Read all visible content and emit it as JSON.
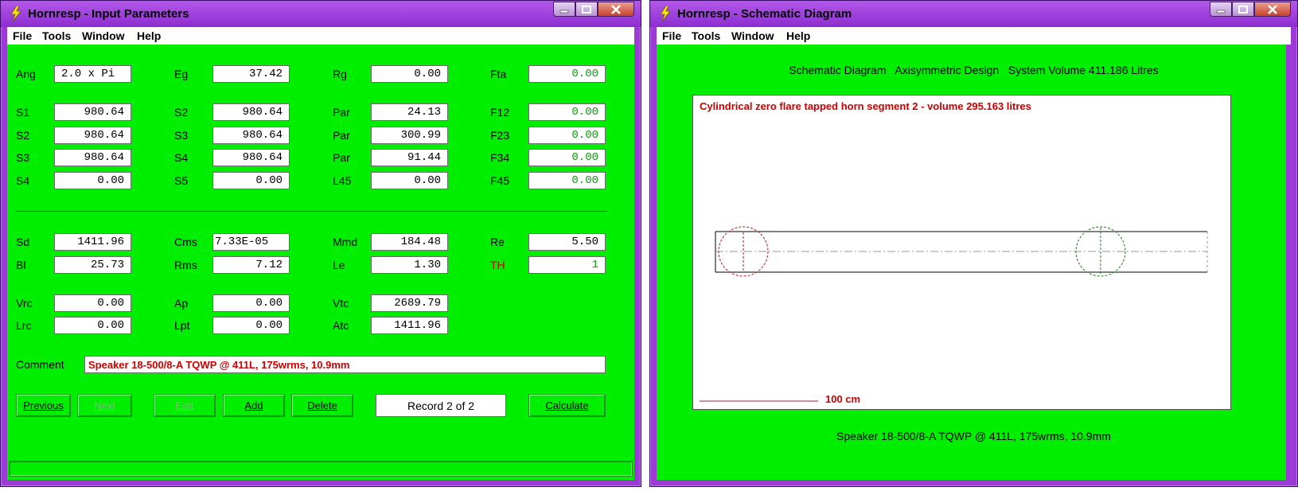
{
  "left_window": {
    "title": "Hornresp - Input Parameters",
    "menu": [
      "File",
      "Tools",
      "Window",
      "Help"
    ],
    "fields": {
      "ang": {
        "label": "Ang",
        "value": "2.0 x Pi"
      },
      "eg": {
        "label": "Eg",
        "value": "37.42"
      },
      "rg": {
        "label": "Rg",
        "value": "0.00"
      },
      "fta": {
        "label": "Fta",
        "value": "0.00"
      },
      "s1": {
        "label": "S1",
        "value": "980.64"
      },
      "s2a": {
        "label": "S2",
        "value": "980.64"
      },
      "par1": {
        "label": "Par",
        "value": "24.13"
      },
      "f12": {
        "label": "F12",
        "value": "0.00"
      },
      "s2b": {
        "label": "S2",
        "value": "980.64"
      },
      "s3a": {
        "label": "S3",
        "value": "980.64"
      },
      "par2": {
        "label": "Par",
        "value": "300.99"
      },
      "f23": {
        "label": "F23",
        "value": "0.00"
      },
      "s3b": {
        "label": "S3",
        "value": "980.64"
      },
      "s4a": {
        "label": "S4",
        "value": "980.64"
      },
      "par3": {
        "label": "Par",
        "value": "91.44"
      },
      "f34": {
        "label": "F34",
        "value": "0.00"
      },
      "s4b": {
        "label": "S4",
        "value": "0.00"
      },
      "s5": {
        "label": "S5",
        "value": "0.00"
      },
      "l45": {
        "label": "L45",
        "value": "0.00"
      },
      "f45": {
        "label": "F45",
        "value": "0.00"
      },
      "sd": {
        "label": "Sd",
        "value": "1411.96"
      },
      "cms": {
        "label": "Cms",
        "value": "7.33E-05"
      },
      "mmd": {
        "label": "Mmd",
        "value": "184.48"
      },
      "re": {
        "label": "Re",
        "value": "5.50"
      },
      "bl": {
        "label": "Bl",
        "value": "25.73"
      },
      "rms": {
        "label": "Rms",
        "value": "7.12"
      },
      "le": {
        "label": "Le",
        "value": "1.30"
      },
      "th": {
        "label": "TH",
        "value": "1"
      },
      "vrc": {
        "label": "Vrc",
        "value": "0.00"
      },
      "ap": {
        "label": "Ap",
        "value": "0.00"
      },
      "vtc": {
        "label": "Vtc",
        "value": "2689.79"
      },
      "lrc": {
        "label": "Lrc",
        "value": "0.00"
      },
      "lpt": {
        "label": "Lpt",
        "value": "0.00"
      },
      "atc": {
        "label": "Atc",
        "value": "1411.96"
      }
    },
    "comment_label": "Comment",
    "comment_value": "Speaker 18-500/8-A TQWP @ 411L, 175wrms, 10.9mm",
    "buttons": {
      "previous": "Previous",
      "next": "Next",
      "edit": "Edit",
      "add": "Add",
      "delete": "Delete",
      "calculate": "Calculate"
    },
    "record": "Record 2 of 2"
  },
  "right_window": {
    "title": "Hornresp - Schematic Diagram",
    "menu": [
      "File",
      "Tools",
      "Window",
      "Help"
    ],
    "caption": "Schematic Diagram   Axisymmetric Design   System Volume 411.186 Litres",
    "segment_label": "Cylindrical zero flare tapped horn segment 2 - volume 295.163 litres",
    "scale_label": "100 cm",
    "footer_comment": "Speaker 18-500/8-A TQWP @ 411L, 175wrms, 10.9mm"
  },
  "colors": {
    "client_green": "#00ee00",
    "title_purple": "#9c3ad6",
    "value_green": "#0a9a0a",
    "label_red": "#cc0000"
  }
}
